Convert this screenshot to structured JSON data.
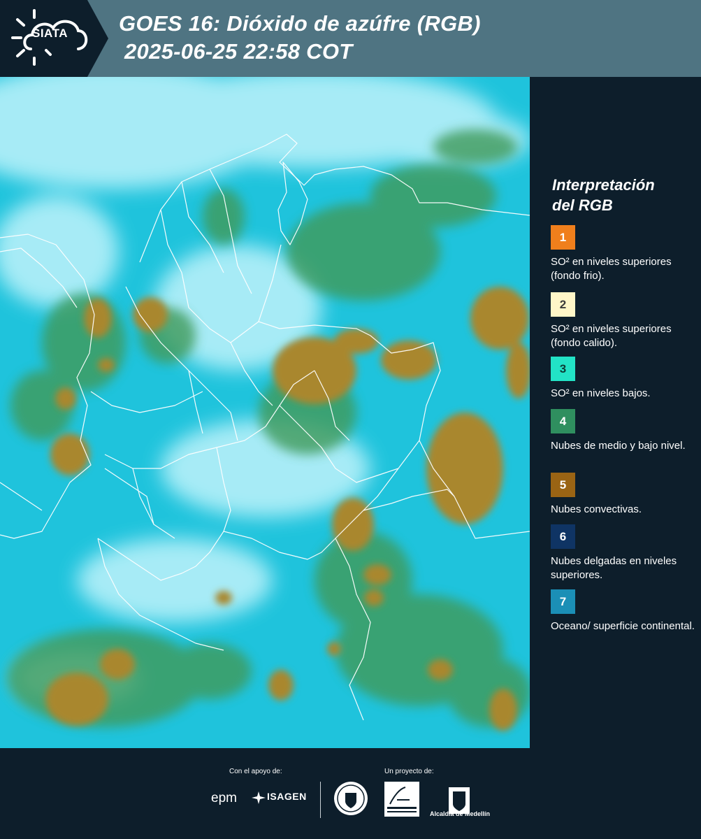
{
  "header": {
    "brand": "SIATA",
    "title_line1": "GOES 16: Dióxido de azúfre (RGB)",
    "title_line2": "2025-06-25 22:58 COT"
  },
  "legend": {
    "title_line1": "Interpretación",
    "title_line2": "del RGB",
    "items": [
      {
        "number": "1",
        "label": "SO² en niveles superiores (fondo frio).",
        "color": "#f07f1c"
      },
      {
        "number": "2",
        "label": "SO² en niveles superiores (fondo calido).",
        "color": "#fff6c8"
      },
      {
        "number": "3",
        "label": "SO² en niveles bajos.",
        "color": "#22e3c6"
      },
      {
        "number": "4",
        "label": "Nubes de medio y bajo nivel.",
        "color": "#2f8f5f"
      },
      {
        "number": "5",
        "label": "Nubes convectivas.",
        "color": "#9a6414"
      },
      {
        "number": "6",
        "label": "Nubes delgadas en niveles superiores.",
        "color": "#0f3464"
      },
      {
        "number": "7",
        "label": "Oceano/ superficie continental.",
        "color": "#1b8fb6"
      }
    ]
  },
  "footer": {
    "support_caption": "Con el apoyo de:",
    "project_caption": "Un proyecto de:",
    "sponsor_epm": "epm",
    "sponsor_isagen": "ISAGEN",
    "partner_alcaldia": "Alcaldía de Medellín"
  },
  "map_colors": {
    "background": "#1fc3dc",
    "haze": "#bff3fb",
    "green_cloud": "#3f9a5a",
    "convective": "#a9872e",
    "boundary": "#ffffff"
  }
}
